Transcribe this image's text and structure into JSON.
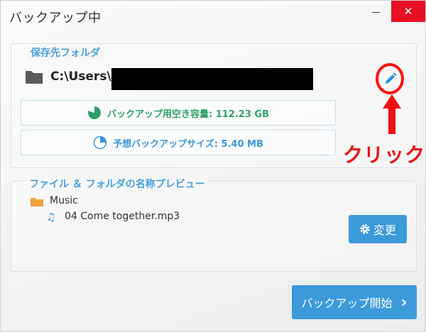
{
  "window": {
    "title": "バックアップ中",
    "minimize_icon": "minimize-icon",
    "close_label": "✕"
  },
  "destination": {
    "legend": "保存先フォルダ",
    "path_prefix": "C:\\Users\\",
    "edit_icon": "pencil-icon",
    "free_space_label": "バックアップ用空き容量: 112.23 GB",
    "estimated_size_label": "予想バックアップサイズ: 5.40 MB"
  },
  "annotation": {
    "text": "クリック",
    "color": "#ee1111"
  },
  "preview": {
    "legend": "ファイル ＆ フォルダの名称プレビュー",
    "folder_name": "Music",
    "file_name": "04 Come together.mp3",
    "change_button": "変更"
  },
  "actions": {
    "start_button": "バックアップ開始"
  },
  "colors": {
    "accent": "#3c9ad9",
    "free_space": "#2ea06a",
    "close": "#e81123"
  }
}
